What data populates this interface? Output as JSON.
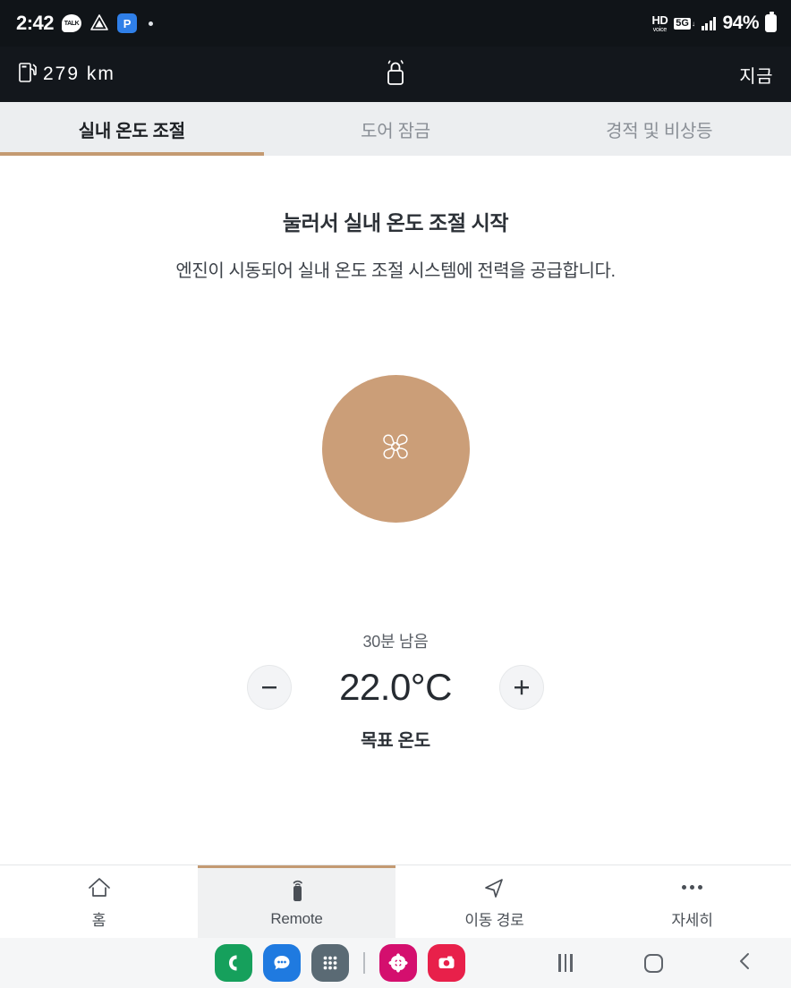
{
  "status_bar": {
    "time": "2:42",
    "icons_left": [
      "kakaotalk-icon",
      "drive-icon",
      "parking-icon",
      "dot-indicator"
    ],
    "kakao_label": "TALK",
    "parking_label": "P",
    "network_hd_top": "HD",
    "network_hd_bottom": "voice",
    "network_5g": "5G",
    "arrow_down": "↓",
    "arrow_up": "↑",
    "battery_percent": "94%"
  },
  "app_bar": {
    "range": "279 km",
    "range_icon": "fuel-pump-icon",
    "center_icon": "unlock-icon",
    "updated": "지금"
  },
  "tabs": {
    "items": [
      {
        "label": "실내 온도 조절",
        "active": true
      },
      {
        "label": "도어 잠금",
        "active": false
      },
      {
        "label": "경적 및 비상등",
        "active": false
      }
    ],
    "accent_color": "#c49a72"
  },
  "main": {
    "headline": "눌러서 실내 온도 조절 시작",
    "subline": "엔진이 시동되어 실내 온도 조절 시스템에 전력을 공급합니다.",
    "dial_icon": "fan-icon",
    "dial_color": "#cb9e78",
    "remaining": "30분 남음",
    "decrease_label": "−",
    "temperature": "22.0°C",
    "increase_label": "+",
    "temperature_label": "목표 온도"
  },
  "bottom_nav": {
    "items": [
      {
        "label": "홈",
        "icon": "home-icon",
        "active": false
      },
      {
        "label": "Remote",
        "icon": "remote-key-icon",
        "active": true
      },
      {
        "label": "이동 경로",
        "icon": "navigation-arrow-icon",
        "active": false
      },
      {
        "label": "자세히",
        "icon": "more-dots-icon",
        "active": false
      }
    ]
  },
  "dock": {
    "apps": [
      {
        "name": "phone-app-icon",
        "color": "#16a05c"
      },
      {
        "name": "messages-app-icon",
        "color": "#1f7ae0"
      },
      {
        "name": "apps-drawer-icon",
        "color": "#5a6a74"
      },
      {
        "name": "gallery-app-icon",
        "color": "#d40f6e"
      },
      {
        "name": "camera-app-icon",
        "color": "#e8204a"
      }
    ],
    "system": [
      "recents-button",
      "home-button",
      "back-button"
    ]
  }
}
